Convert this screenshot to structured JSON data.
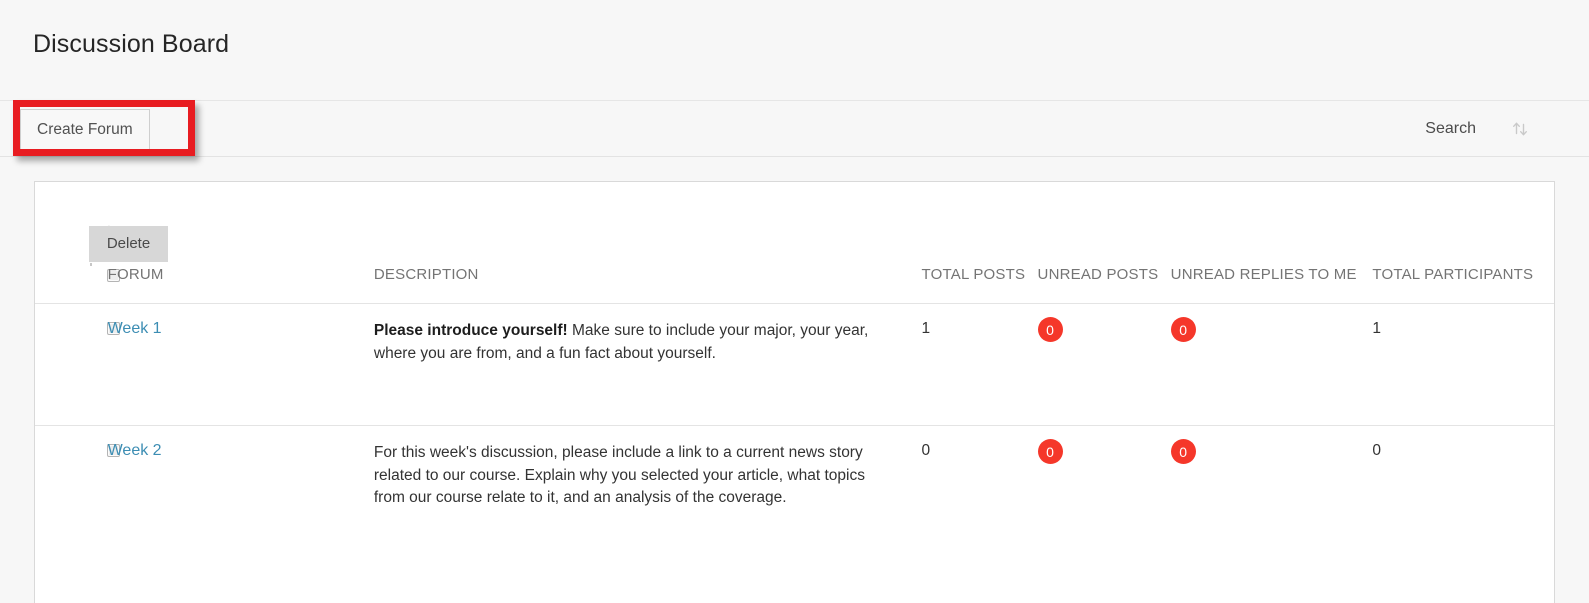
{
  "page": {
    "title": "Discussion Board",
    "background_color": "#f7f7f7",
    "card_background": "#ffffff"
  },
  "action_bar": {
    "create_forum_label": "Create Forum",
    "search_label": "Search",
    "sort_icon": "sort-updown-icon",
    "annotation": {
      "target": "create-forum-button",
      "color": "#e81c21"
    }
  },
  "toolbar": {
    "delete_label": "Delete",
    "pointer_icon": "dotted-arrow-icon"
  },
  "table": {
    "headers": {
      "select_all": "",
      "forum": "FORUM",
      "description": "DESCRIPTION",
      "total_posts": "TOTAL POSTS",
      "unread_posts": "UNREAD POSTS",
      "unread_replies_to_me": "UNREAD REPLIES TO ME",
      "total_participants": "TOTAL PARTICIPANTS"
    },
    "badge_color": "#f5372a",
    "link_color": "#3c8db3",
    "rows": [
      {
        "forum": "Week 1",
        "description_bold": "Please introduce yourself!",
        "description_rest": " Make sure to include your major, your year, where you are from, and a fun fact about yourself.",
        "total_posts": "1",
        "unread_posts": "0",
        "unread_replies_to_me": "0",
        "total_participants": "1"
      },
      {
        "forum": "Week 2",
        "description_bold": "",
        "description_rest": "For this week's discussion, please include a link to a current news story related to our course. Explain why you selected your article, what topics from our course relate to it, and an analysis of the coverage.",
        "total_posts": "0",
        "unread_posts": "0",
        "unread_replies_to_me": "0",
        "total_participants": "0"
      }
    ]
  }
}
